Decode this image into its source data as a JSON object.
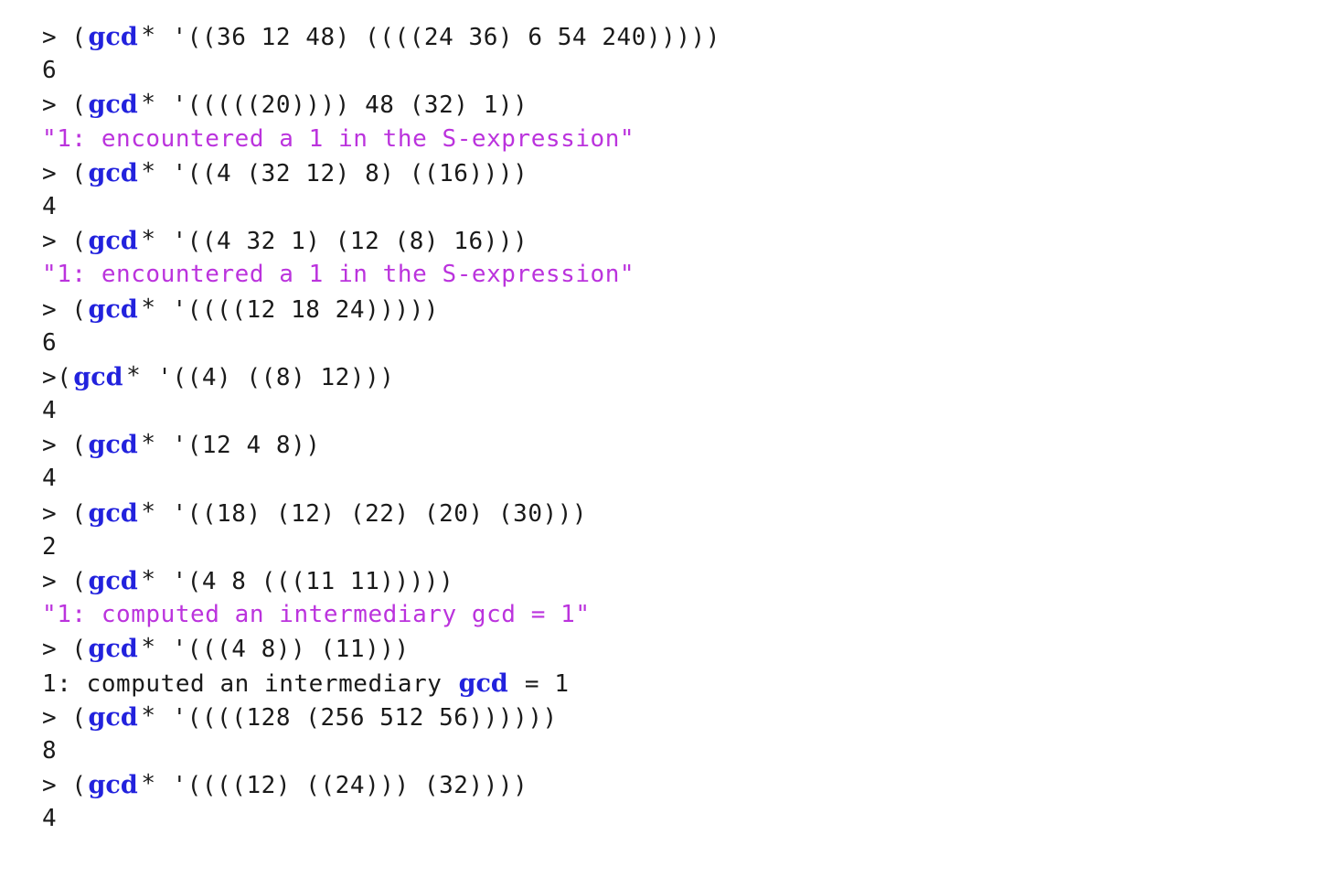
{
  "window": {
    "title": "gcd* REPL transcript",
    "background_color": "#ffffff"
  },
  "colors": {
    "text": "#1a1a1a",
    "identifier_blue": "#2222dd",
    "output_magenta": "#bb33dd"
  },
  "glyphs": {
    "prompt": ">",
    "star": "*",
    "quote_mark": "\"",
    "open_paren": "(",
    "close_paren": ")",
    "tick": "'"
  },
  "transcript": {
    "identifier": "gcd",
    "lines": [
      {
        "kind": "input",
        "color": "#1a1a1a",
        "prompt": "> ",
        "pre": "(",
        "identifier": "gcd",
        "star": "*",
        "post": " '((36 12 48) ((((24 36) 6 54 240)))))"
      },
      {
        "kind": "result",
        "color": "#1a1a1a",
        "text": "6"
      },
      {
        "kind": "input",
        "color": "#1a1a1a",
        "prompt": "> ",
        "pre": "(",
        "identifier": "gcd",
        "star": "*",
        "post": " '(((((20)))) 48 (32) 1))"
      },
      {
        "kind": "output-string",
        "color": "#bb33dd",
        "text": "\"1: encountered a 1 in the S-expression\""
      },
      {
        "kind": "input",
        "color": "#1a1a1a",
        "prompt": "> ",
        "pre": "(",
        "identifier": "gcd",
        "star": "*",
        "post": " '((4 (32 12) 8) ((16))))"
      },
      {
        "kind": "result",
        "color": "#1a1a1a",
        "text": "4"
      },
      {
        "kind": "input",
        "color": "#1a1a1a",
        "prompt": "> ",
        "pre": "(",
        "identifier": "gcd",
        "star": "*",
        "post": " '((4 32 1) (12 (8) 16)))"
      },
      {
        "kind": "output-string",
        "color": "#bb33dd",
        "text": "\"1: encountered a 1 in the S-expression\""
      },
      {
        "kind": "input",
        "color": "#1a1a1a",
        "prompt": "> ",
        "pre": "(",
        "identifier": "gcd",
        "star": "*",
        "post": " '((((12 18 24)))))"
      },
      {
        "kind": "result",
        "color": "#1a1a1a",
        "text": "6"
      },
      {
        "kind": "input",
        "color": "#1a1a1a",
        "prompt": ">",
        "pre": "(",
        "identifier": "gcd",
        "star": "*",
        "post": " '((4) ((8) 12)))"
      },
      {
        "kind": "result",
        "color": "#1a1a1a",
        "text": "4"
      },
      {
        "kind": "input",
        "color": "#1a1a1a",
        "prompt": "> ",
        "pre": "(",
        "identifier": "gcd",
        "star": "*",
        "post": " '(12 4 8))"
      },
      {
        "kind": "result",
        "color": "#1a1a1a",
        "text": "4"
      },
      {
        "kind": "input",
        "color": "#1a1a1a",
        "prompt": "> ",
        "pre": "(",
        "identifier": "gcd",
        "star": "*",
        "post": " '((18) (12) (22) (20) (30)))"
      },
      {
        "kind": "result",
        "color": "#1a1a1a",
        "text": "2"
      },
      {
        "kind": "input",
        "color": "#1a1a1a",
        "prompt": "> ",
        "pre": "(",
        "identifier": "gcd",
        "star": "*",
        "post": " '(4 8 (((11 11)))))"
      },
      {
        "kind": "output-string",
        "color": "#bb33dd",
        "text": "\"1: computed an intermediary gcd = 1\""
      },
      {
        "kind": "input",
        "color": "#1a1a1a",
        "prompt": "> ",
        "pre": "(",
        "identifier": "gcd",
        "star": "*",
        "post": " '(((4 8)) (11)))"
      },
      {
        "kind": "output-mixed",
        "color": "#1a1a1a",
        "before": "1: computed an intermediary ",
        "identifier": "gcd",
        "after": " = 1"
      },
      {
        "kind": "input",
        "color": "#1a1a1a",
        "prompt": "> ",
        "pre": "(",
        "identifier": "gcd",
        "star": "*",
        "post": " '((((128 (256 512 56))))))"
      },
      {
        "kind": "result",
        "color": "#1a1a1a",
        "text": "8"
      },
      {
        "kind": "input",
        "color": "#1a1a1a",
        "prompt": "> ",
        "pre": "(",
        "identifier": "gcd",
        "star": "*",
        "post": " '((((12) ((24))) (32))))"
      },
      {
        "kind": "result",
        "color": "#1a1a1a",
        "text": "4"
      }
    ]
  }
}
